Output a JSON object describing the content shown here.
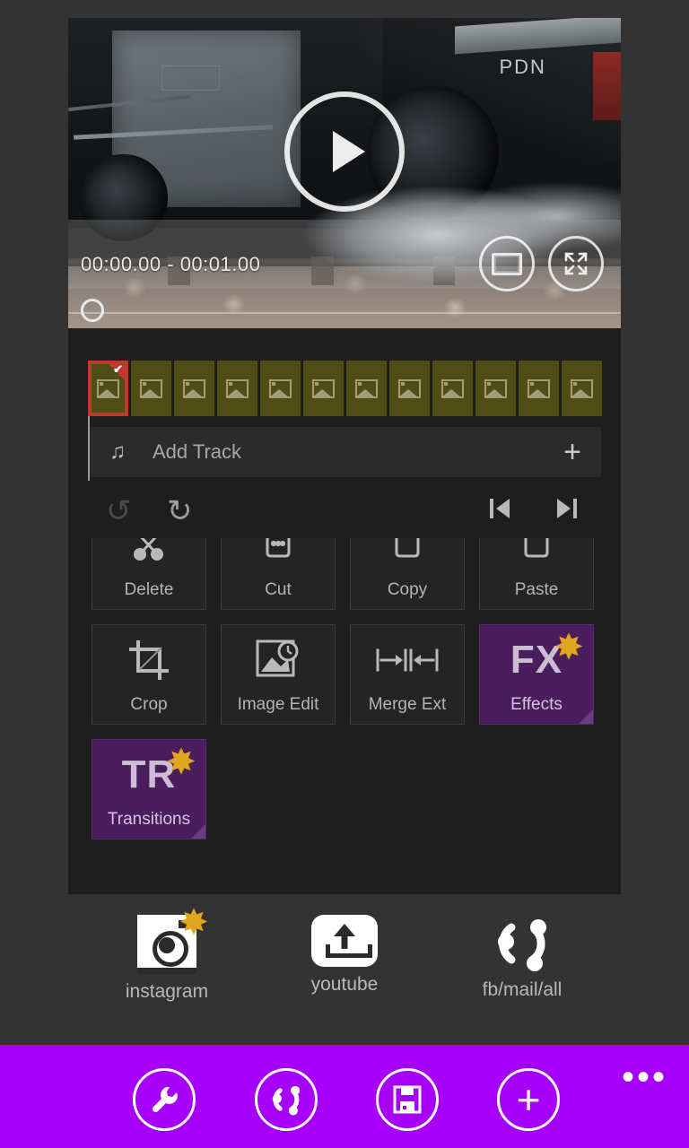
{
  "player": {
    "time_range": "00:00.00  -  00:01.00",
    "play_label": "play",
    "ratio_icon": "aspect-ratio-icon",
    "fullscreen_icon": "fullscreen-icon",
    "scrubber_position": "0"
  },
  "timeline": {
    "frames": [
      {
        "id": 1,
        "selected": true
      },
      {
        "id": 2,
        "selected": false
      },
      {
        "id": 3,
        "selected": false
      },
      {
        "id": 4,
        "selected": false
      },
      {
        "id": 5,
        "selected": false
      },
      {
        "id": 6,
        "selected": false
      },
      {
        "id": 7,
        "selected": false
      },
      {
        "id": 8,
        "selected": false
      },
      {
        "id": 9,
        "selected": false
      },
      {
        "id": 10,
        "selected": false
      },
      {
        "id": 11,
        "selected": false
      },
      {
        "id": 12,
        "selected": false
      }
    ],
    "checkmark": "✔",
    "add_track": {
      "label": "Add Track",
      "note_icon": "♫",
      "plus_icon": "+"
    }
  },
  "nav": {
    "undo_icon": "↺",
    "redo_icon": "↻",
    "prev_label": "previous",
    "next_label": "next"
  },
  "tools": {
    "row1": [
      {
        "label": "Delete",
        "icon": "scissors-icon",
        "highlight": false
      },
      {
        "label": "Cut",
        "icon": "cut-icon",
        "highlight": false
      },
      {
        "label": "Copy",
        "icon": "copy-icon",
        "highlight": false
      },
      {
        "label": "Paste",
        "icon": "paste-icon",
        "highlight": false
      }
    ],
    "row2": [
      {
        "label": "Crop",
        "icon": "crop-icon",
        "highlight": false
      },
      {
        "label": "Image Edit",
        "icon": "image-edit-icon",
        "highlight": false
      },
      {
        "label": "Merge Ext",
        "icon": "merge-icon",
        "highlight": false
      },
      {
        "label": "Effects",
        "icon": "fx-icon",
        "badge": "✸",
        "text": "FX",
        "highlight": true
      }
    ],
    "row3": [
      {
        "label": "Transitions",
        "icon": "transitions-icon",
        "badge": "✸",
        "text": "TR",
        "highlight": true
      }
    ]
  },
  "share": [
    {
      "label": "instagram",
      "icon": "instagram-icon",
      "badge": "✸"
    },
    {
      "label": "youtube",
      "icon": "youtube-upload-icon"
    },
    {
      "label": "fb/mail/all",
      "icon": "share-all-icon"
    }
  ],
  "appbar": {
    "buttons": [
      {
        "name": "settings",
        "icon": "wrench-icon",
        "glyph": "🔧"
      },
      {
        "name": "share",
        "icon": "share-icon"
      },
      {
        "name": "save",
        "icon": "save-icon"
      },
      {
        "name": "add",
        "icon": "plus-icon",
        "glyph": "+"
      }
    ],
    "more_icon": "•••"
  },
  "colors": {
    "accent": "#a600fa",
    "panel": "#1e1e1e",
    "page": "#333333",
    "filmstrip": "#4f4d14",
    "selection": "#c0392b",
    "tile_purple": "#4a1e5c",
    "badge": "#e0a61e"
  }
}
